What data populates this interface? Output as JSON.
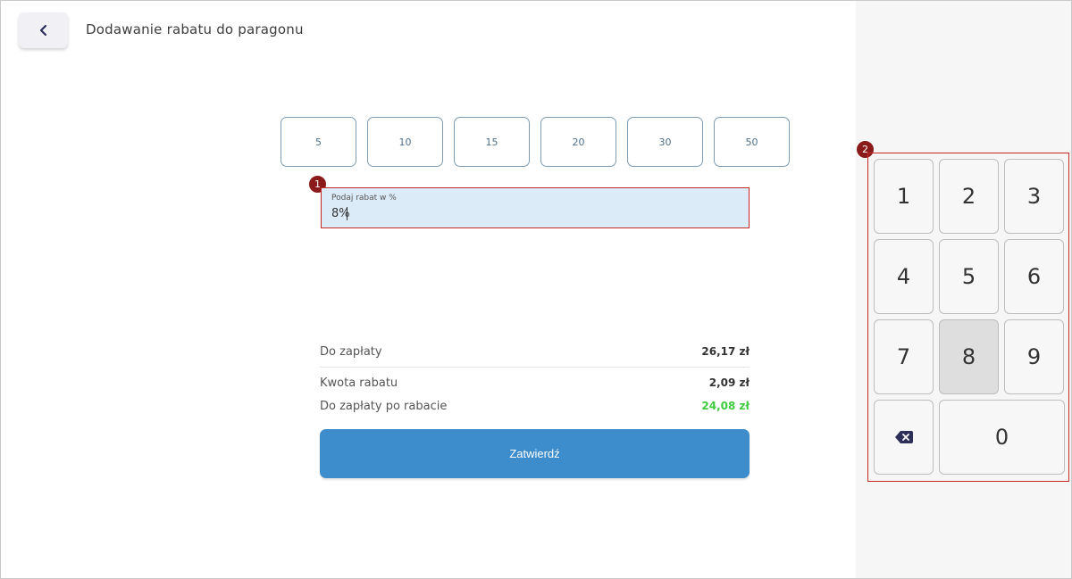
{
  "header": {
    "title": "Dodawanie rabatu do paragonu",
    "back_icon": "chevron-left-icon"
  },
  "presets": [
    "5",
    "10",
    "15",
    "20",
    "30",
    "50"
  ],
  "discount_input": {
    "label": "Podaj rabat w %",
    "value": "8%"
  },
  "summary": {
    "to_pay_label": "Do zapłaty",
    "to_pay_value": "26,17 zł",
    "discount_amount_label": "Kwota rabatu",
    "discount_amount_value": "2,09 zł",
    "after_discount_label": "Do zapłaty po rabacie",
    "after_discount_value": "24,08 zł"
  },
  "confirm_button": {
    "label": "Zatwierdź"
  },
  "keypad": {
    "keys": [
      "1",
      "2",
      "3",
      "4",
      "5",
      "6",
      "7",
      "8",
      "9",
      "0"
    ],
    "pressed_key": "8",
    "backspace_icon": "backspace-icon"
  },
  "annotations": {
    "badge_1": "1",
    "badge_2": "2"
  },
  "colors": {
    "accent": "#3d8ccb",
    "input_bg": "#dcebf8",
    "highlight_red": "#c62828",
    "badge_red": "#8b1a1a",
    "success_green": "#3ecb3e"
  }
}
